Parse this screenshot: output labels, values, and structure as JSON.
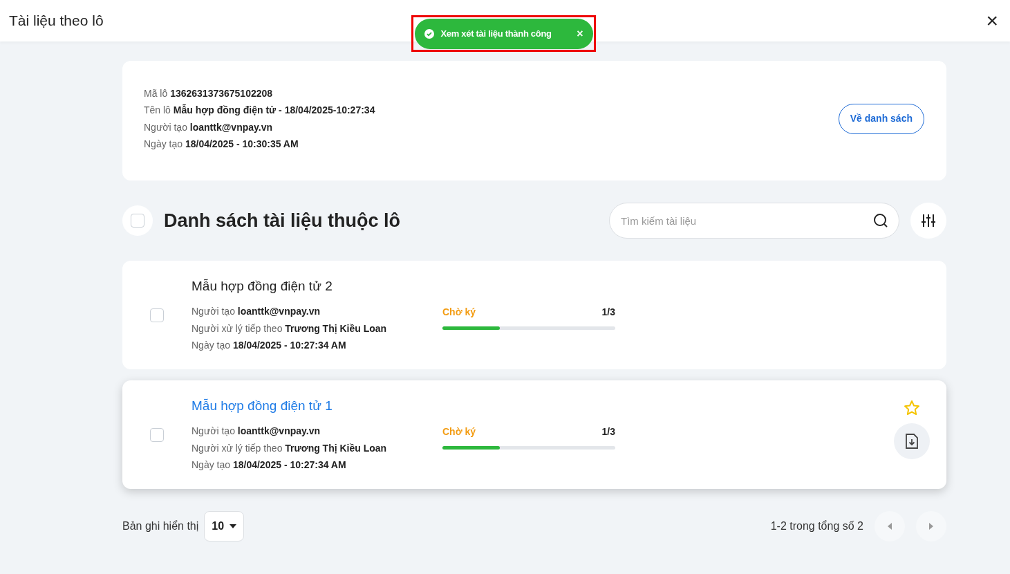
{
  "header": {
    "title": "Tài liệu theo lô",
    "close": "×"
  },
  "toast": {
    "message": "Xem xét tài liệu thành công",
    "close": "×"
  },
  "batch": {
    "fields": [
      {
        "label": "Mã lô",
        "value": "1362631373675102208"
      },
      {
        "label": "Tên lô",
        "value": "Mẫu hợp đồng điện tử - 18/04/2025-10:27:34"
      },
      {
        "label": "Người tạo",
        "value": "loanttk@vnpay.vn"
      },
      {
        "label": "Ngày tạo",
        "value": "18/04/2025 - 10:30:35 AM"
      }
    ],
    "back_button": "Về danh sách"
  },
  "list": {
    "title": "Danh sách tài liệu thuộc lô",
    "select_all_checked": false,
    "search": {
      "placeholder": "Tìm kiếm tài liệu"
    }
  },
  "documents": [
    {
      "title": "Mẫu hợp đồng điện tử 2",
      "hovered": false,
      "checked": false,
      "fields": [
        {
          "label": "Người tạo",
          "value": "loanttk@vnpay.vn"
        },
        {
          "label": "Người xử lý tiếp theo",
          "value": "Trương Thị Kiều Loan"
        },
        {
          "label": "Ngày tạo",
          "value": "18/04/2025 - 10:27:34 AM"
        }
      ],
      "status": "Chờ ký",
      "progress": "1/3",
      "level": 0.333
    },
    {
      "title": "Mẫu hợp đồng điện tử 1",
      "hovered": true,
      "checked": false,
      "fields": [
        {
          "label": "Người tạo",
          "value": "loanttk@vnpay.vn"
        },
        {
          "label": "Người xử lý tiếp theo",
          "value": "Trương Thị Kiều Loan"
        },
        {
          "label": "Ngày tạo",
          "value": "18/04/2025 - 10:27:34 AM"
        }
      ],
      "status": "Chờ ký",
      "progress": "1/3",
      "level": 0.333
    }
  ],
  "footer": {
    "page_size_label": "Bản ghi hiển thị",
    "page_size": "10",
    "range": "1-2 trong tổng số 2"
  }
}
